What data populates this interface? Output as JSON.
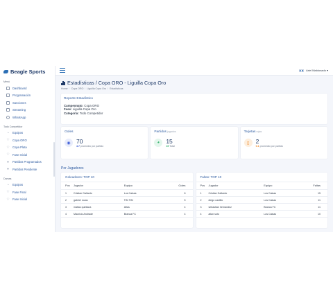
{
  "app": {
    "brand": "Beagle Sports"
  },
  "topbar": {
    "user_name": "Ariel Maldonado"
  },
  "sidebar": {
    "sections": [
      {
        "label": "Menú",
        "items": [
          {
            "label": "Dashboard",
            "icon": "dashboard-icon"
          },
          {
            "label": "Programación",
            "icon": "calendar-icon"
          },
          {
            "label": "Sanciones",
            "icon": "sanctions-icon"
          },
          {
            "label": "Streaming",
            "icon": "video-icon"
          },
          {
            "label": "WhatsApp",
            "icon": "whatsapp-icon"
          }
        ]
      },
      {
        "label": "Todo Competidor",
        "items": [
          {
            "label": "Equipos",
            "icon": "users-icon"
          },
          {
            "label": "Copa ORO",
            "icon": "trophy-icon"
          },
          {
            "label": "Copa Plata",
            "icon": "trophy-icon"
          },
          {
            "label": "Fase Inicial",
            "icon": "trophy-icon"
          },
          {
            "label": "Partidos Programados",
            "icon": "dot-icon"
          },
          {
            "label": "Partidos Pendiente",
            "icon": "dot-icon"
          }
        ]
      },
      {
        "label": "Damas",
        "items": [
          {
            "label": "Equipos",
            "icon": "users-icon"
          },
          {
            "label": "Fase Final",
            "icon": "trophy-icon"
          },
          {
            "label": "Fase Inicial",
            "icon": "trophy-icon"
          }
        ]
      }
    ]
  },
  "page": {
    "title": "Estadísticas / Copa ORO - Liguilla Copa Oro",
    "breadcrumbs": [
      "Home",
      "Copa ORO",
      "Liguilla Copa Oro",
      "Estadísticas"
    ]
  },
  "report": {
    "title": "Reporte Estadístico",
    "lines": [
      {
        "key": "Campeonato:",
        "value": "Copa ORO"
      },
      {
        "key": "Fase:",
        "value": "Liguilla Copa Oro"
      },
      {
        "key": "Categoría:",
        "value": "Todo Competidor"
      }
    ]
  },
  "stats": [
    {
      "title": "Goles",
      "note": "",
      "value": "70",
      "sub_value": "4.7",
      "sub_text": "promedio por partido",
      "icon": "soccer-ball-icon",
      "color": "#3b5bd6",
      "bg": "#e8ecfb"
    },
    {
      "title": "Partidos",
      "note": "jugados",
      "value": "15",
      "sub_value": "15",
      "sub_text": "Total",
      "icon": "pie-chart-icon",
      "color": "#2fb06a",
      "bg": "#e3f6ec"
    },
    {
      "title": "Tarjetas",
      "note": "rojas",
      "value": "2",
      "sub_value": "0.1",
      "sub_text": "promedio por partido",
      "icon": "card-icon",
      "color": "#f08a2b",
      "bg": "#fdeedd"
    }
  ],
  "section_por_jugadores": "Por Jugadores",
  "goleadores": {
    "title": "Goleadores: TOP 10",
    "headers": [
      "Pos",
      "Jugador",
      "Equipo",
      "Goles"
    ],
    "rows": [
      [
        "1",
        "Cristian Gallardo",
        "Los Caisas",
        "6"
      ],
      [
        "2",
        "gabriel rozas",
        "TiKi TiKi",
        "5"
      ],
      [
        "3",
        "matias quintana",
        "Atlas",
        "4"
      ],
      [
        "4",
        "Mauricio Andrade",
        "Branca FC",
        "4"
      ]
    ]
  },
  "faltas": {
    "title": "Faltas: TOP 10",
    "headers": [
      "Pos",
      "Jugador",
      "Equipo",
      "Faltas"
    ],
    "rows": [
      [
        "1",
        "Cristian Gallardo",
        "Los Caisas",
        "15"
      ],
      [
        "2",
        "diego castillo",
        "Los Caisas",
        "11"
      ],
      [
        "3",
        "sebastian hernandez",
        "Branca FC",
        "11"
      ],
      [
        "4",
        "allan soto",
        "Los Caisas",
        "10"
      ]
    ]
  }
}
